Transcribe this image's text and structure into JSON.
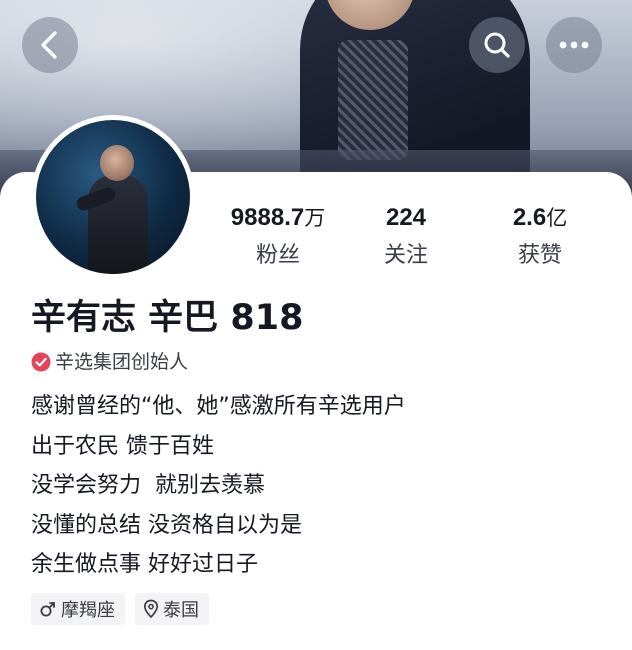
{
  "header": {
    "back_icon": "chevron-left-icon",
    "search_icon": "search-icon",
    "more_icon": "more-horizontal-icon"
  },
  "profile": {
    "name": "辛有志 辛巴 818",
    "verified_text": "辛选集团创始人",
    "verify_color": "#e5435a",
    "stats": {
      "fans": {
        "value": "9888.7",
        "unit": "万",
        "label": "粉丝"
      },
      "following": {
        "value": "224",
        "unit": "",
        "label": "关注"
      },
      "likes": {
        "value": "2.6",
        "unit": "亿",
        "label": "获赞"
      }
    },
    "bio": [
      "感谢曾经的“他、她”感激所有辛选用户",
      "出于农民 馈于百姓",
      "没学会努力  就别去羡慕",
      "没懂的总结 没资格自以为是",
      "余生做点事 好好过日子"
    ],
    "tags": [
      {
        "icon": "male-icon",
        "label": "摩羯座"
      },
      {
        "icon": "location-pin-icon",
        "label": "泰国"
      }
    ]
  }
}
